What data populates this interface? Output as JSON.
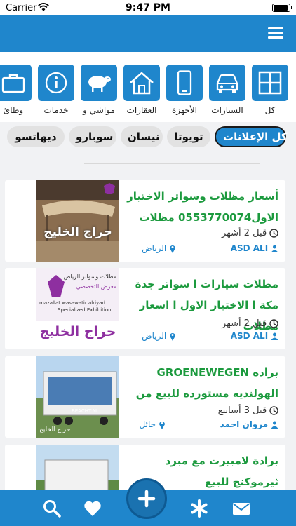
{
  "status": {
    "carrier": "Carrier",
    "time": "9:47 PM",
    "battery_level": 0.95
  },
  "categories": [
    {
      "label": "كل",
      "icon": "grid-icon"
    },
    {
      "label": "السيارات",
      "icon": "car-icon"
    },
    {
      "label": "الأجهزة",
      "icon": "phone-icon"
    },
    {
      "label": "العقارات",
      "icon": "house-icon"
    },
    {
      "label": "مواشي و",
      "icon": "sheep-icon"
    },
    {
      "label": "خدمات",
      "icon": "info-icon"
    },
    {
      "label": "وظائ",
      "icon": "briefcase-icon"
    }
  ],
  "filters": [
    "كل الإعلانات",
    "تويوتا",
    "نيسان",
    "سوبارو",
    "ديهاتسو"
  ],
  "listings": [
    {
      "title": "أسعار مظلات وسواتر الاختيار الاول0553770074 مظلات",
      "time": "قبل 2 أشهر",
      "user": "ASD ALI",
      "location": "الرياض",
      "thumb_text": "حراج الخليج"
    },
    {
      "title": "مظلات سيارات ا سواتر جدة مكة ا الاختيار الاول ا اسعار مظلات",
      "time": "قبل 2 أشهر",
      "user": "ASD ALI",
      "location": "الرياض",
      "thumb_text": "حراج الخليج",
      "thumb_heading": "مظلات وسواتر الرياض",
      "thumb_sub": "معرض التخصصي",
      "thumb_en": "mazallat wasawatir alriyad",
      "thumb_en2": "Specialized Exhibition"
    },
    {
      "title": "براده GROENEWEGEN الهولنديه مستورده للبيع من",
      "time": "قبل 3 أسابيع",
      "user": "مروان احمد",
      "location": "حائل",
      "thumb_text": "حراج الخليج",
      "thumb_brand": "BEACHT.NL"
    },
    {
      "title": "برادة لامبيرت مع مبرد ثيرموكنج للبيع",
      "time": "",
      "user": "",
      "location": "",
      "thumb_text": ""
    }
  ],
  "tabs": [
    "search-icon",
    "heart-icon",
    "add-icon",
    "asterisk-icon",
    "mail-icon"
  ],
  "colors": {
    "primary": "#1f86cc",
    "title_green": "#1c9a3e",
    "chip_bg": "#e2e2e2"
  }
}
